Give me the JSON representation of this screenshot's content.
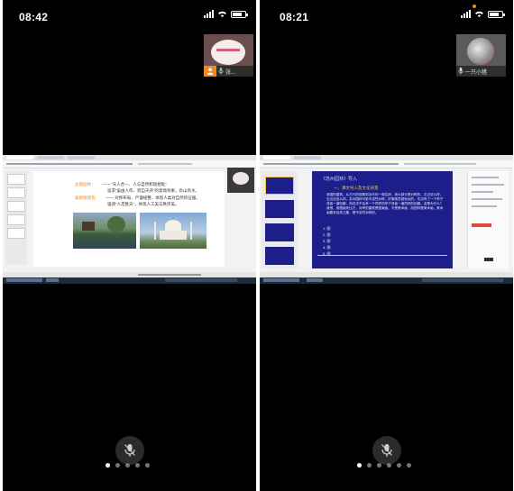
{
  "left_phone": {
    "time": "08:42",
    "participant_name": "张...",
    "slide": {
      "line1_label": "古典园林：",
      "line1_text": "—— “天人合一、人与自然和谐相处”",
      "line2_text": "追求“虽由人作、宛自天开”的意境效果，有山有水。",
      "line3_label": "泰姬陵建筑：",
      "line3_text": "—— 对称布局、严谨规整、体现人类对自然的征服。",
      "line4_text": "强调“人定胜天”，体现人工美与秩序美。"
    },
    "dots_count": 5,
    "active_dot": 0
  },
  "right_phone": {
    "time": "08:21",
    "participant_name": "一只小猪",
    "slide": {
      "title": "《苏州园林》导入",
      "subtitle": "一、课文导入及文化背景",
      "body_lines": [
        "我国的建筑，从古代的宫殿到近代的一般住房，绝大部分是对称的，左边怎么样，",
        "右边也怎么样。苏州园林可绝不讲究对称，好像故意避免似的。东边有了一个亭子",
        "或者一道回廊，西边决不会来一个同样的亭子或者一道同样的回廊。这是为什么？",
        "我想，用图画来比方，对称的建筑是图案画，不是美术画，而园林是美术画，美术",
        "画要求自然之趣，是不讲究对称的。"
      ],
      "list_items": [
        "1. 图",
        "2. 图",
        "3. 图",
        "4. 图",
        "5. 图"
      ]
    },
    "dots_count": 6,
    "active_dot": 0
  },
  "colors": {
    "phone_bg": "#000000",
    "slide_blue": "#1c1f8a",
    "accent_orange": "#f08a24",
    "accent_gold": "#f3c34a",
    "slide_text_blue": "#2c3ea8"
  }
}
